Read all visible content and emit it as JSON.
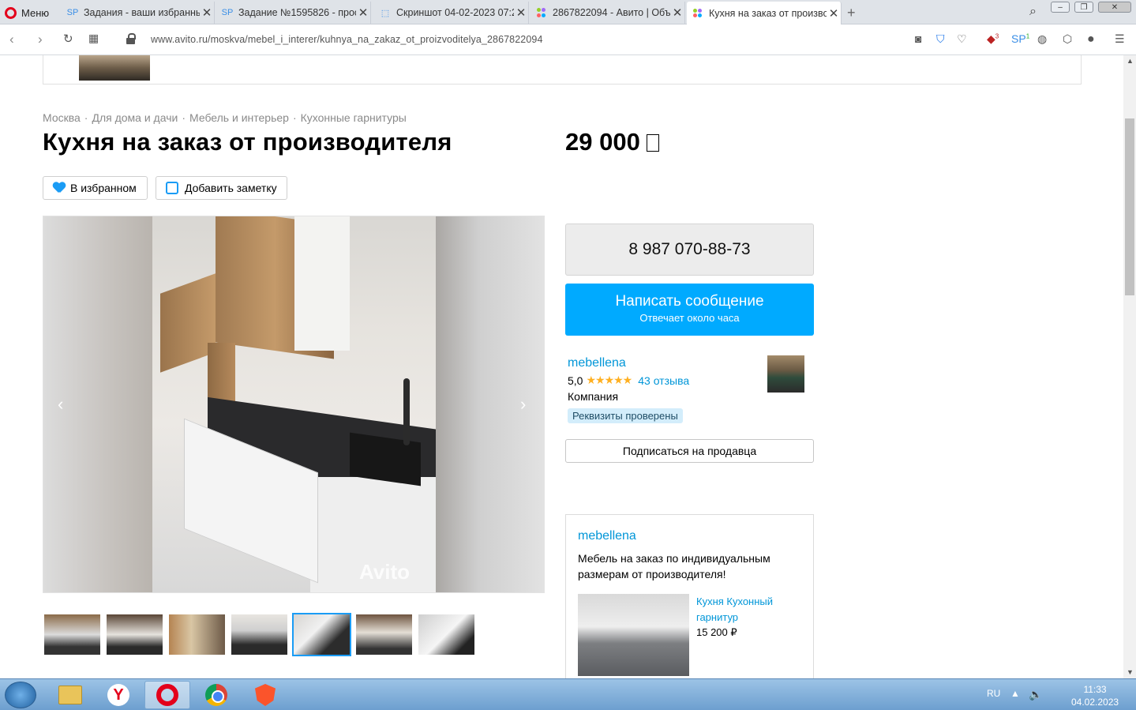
{
  "browser": {
    "menu_label": "Меню",
    "tabs": [
      {
        "icon": "sp-icon",
        "title": "Задания - ваши избранные"
      },
      {
        "icon": "sp-icon",
        "title": "Задание №1595826 - прос"
      },
      {
        "icon": "screenshot-icon",
        "title": "Скриншот 04-02-2023 07:2"
      },
      {
        "icon": "avito-icon",
        "title": "2867822094 - Авито | Объ"
      },
      {
        "icon": "avito-icon",
        "title": "Кухня на заказ от произво"
      }
    ],
    "url": "www.avito.ru/moskva/mebel_i_interer/kuhnya_na_zakaz_ot_proizvoditelya_2867822094",
    "ext_badges": [
      "3",
      "1"
    ]
  },
  "page": {
    "breadcrumb": [
      "Москва",
      "Для дома и дачи",
      "Мебель и интерьер",
      "Кухонные гарнитуры"
    ],
    "breadcrumb_sep": "·",
    "title": "Кухня на заказ от производителя",
    "price": "29 000",
    "favorite_label": "В избранном",
    "note_label": "Добавить заметку",
    "watermark": "Avito",
    "gallery_prev": "‹",
    "gallery_next": "›",
    "thumbnails_count": 7,
    "selected_thumbnail_index": 4
  },
  "contact": {
    "phone": "8 987 070-88-73",
    "message_label": "Написать сообщение",
    "message_sub": "Отвечает около часа"
  },
  "seller": {
    "name": "mebellena",
    "rating": "5,0",
    "stars": "★★★★★",
    "reviews": "43 отзыва",
    "type": "Компания",
    "verified": "Реквизиты проверены",
    "subscribe_label": "Подписаться на продавца"
  },
  "seller_card": {
    "name": "mebellena",
    "description": "Мебель на заказ по индивидуальным размерам от производителя!",
    "item_title": "Кухня Кухонный гарнитур",
    "item_price": "15 200 ₽"
  },
  "taskbar": {
    "lang": "RU",
    "time": "11:33",
    "date": "04.02.2023"
  },
  "colors": {
    "accent": "#00aaff",
    "link": "#0096d8",
    "star": "#ffb021"
  }
}
